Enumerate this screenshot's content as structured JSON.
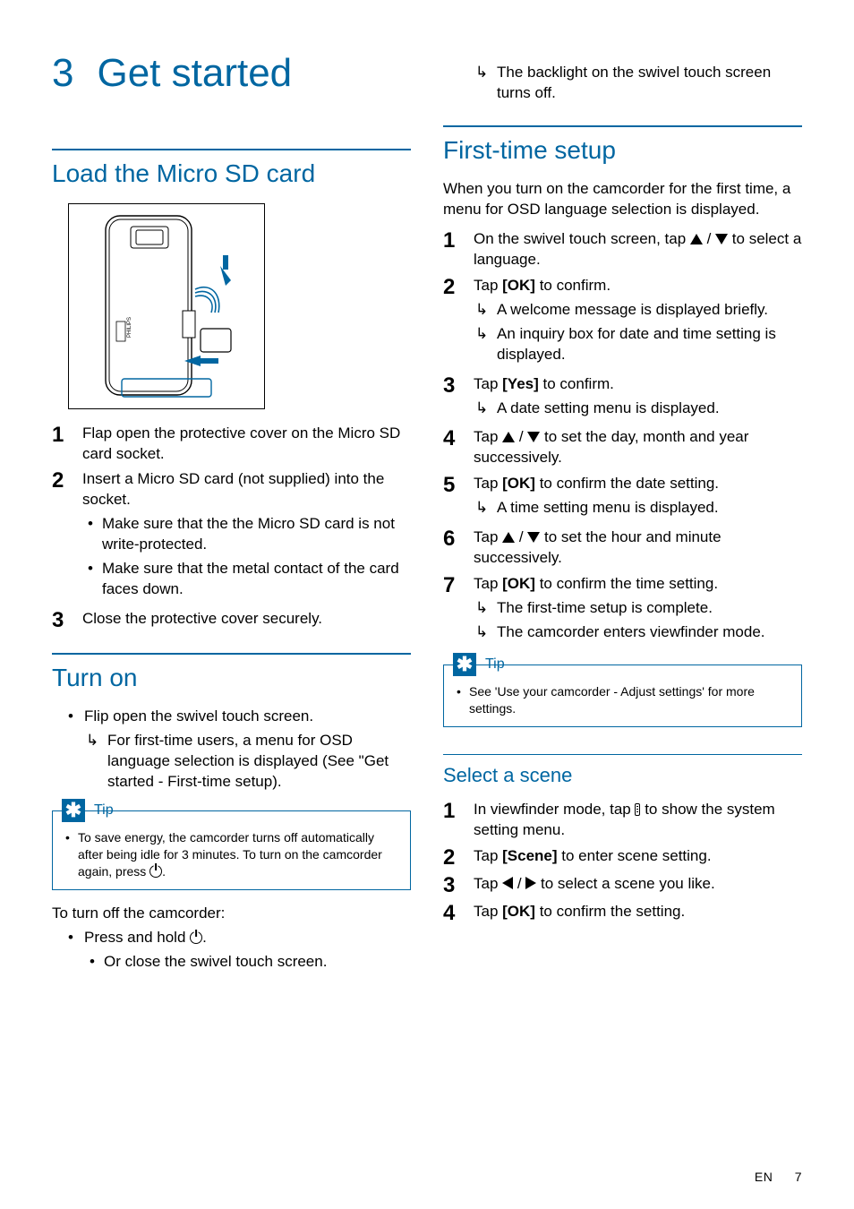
{
  "chapter": {
    "number": "3",
    "title": "Get started"
  },
  "sections": {
    "load_sd": {
      "heading": "Load the Micro SD card",
      "steps": [
        {
          "text": "Flap open the protective cover on the Micro SD card socket."
        },
        {
          "text": "Insert a Micro SD card (not supplied) into the socket.",
          "bullets": [
            "Make sure that the the Micro SD card is not write-protected.",
            "Make sure that the metal contact of the card faces down."
          ]
        },
        {
          "text": "Close the protective cover securely."
        }
      ]
    },
    "turn_on": {
      "heading": "Turn on",
      "bullets": [
        {
          "text": "Flip open the swivel touch screen.",
          "results": [
            "For first-time users, a menu for OSD language selection is displayed (See \"Get started - First-time setup)."
          ]
        }
      ],
      "tip_label": "Tip",
      "tip_text_a": "To save energy, the camcorder turns off automatically after being idle for 3 minutes. To turn on the camcorder again, press ",
      "tip_text_b": ".",
      "turn_off_heading": "To turn off the camcorder:",
      "turn_off_main_a": "Press and hold ",
      "turn_off_main_b": ".",
      "turn_off_sub": "Or close the swivel touch screen.",
      "turn_off_result": "The backlight on the swivel touch screen turns off."
    },
    "first_time": {
      "heading": "First-time setup",
      "intro": "When you turn on the camcorder for the first time, a menu for OSD language selection is displayed.",
      "steps": [
        {
          "pre": "On the swivel touch screen, tap ",
          "post": " to select a language.",
          "icons": "updown"
        },
        {
          "pre": "Tap ",
          "bold": "[OK]",
          "post": " to confirm.",
          "results": [
            "A welcome message is displayed briefly.",
            "An inquiry box for date and time setting is displayed."
          ]
        },
        {
          "pre": "Tap ",
          "bold": "[Yes]",
          "post": " to confirm.",
          "results": [
            "A date setting menu is displayed."
          ]
        },
        {
          "pre": "Tap ",
          "post": " to set the day, month and year successively.",
          "icons": "updown"
        },
        {
          "pre": "Tap ",
          "bold": "[OK]",
          "post": " to confirm the date setting.",
          "results": [
            "A time setting menu is displayed."
          ]
        },
        {
          "pre": "Tap ",
          "post": " to set the hour and minute successively.",
          "icons": "updown"
        },
        {
          "pre": "Tap ",
          "bold": "[OK]",
          "post": " to confirm the time setting.",
          "results": [
            "The first-time setup is complete.",
            "The camcorder enters viewfinder mode."
          ]
        }
      ],
      "tip_label": "Tip",
      "tip_text": "See 'Use your camcorder - Adjust settings' for more settings."
    },
    "select_scene": {
      "heading": "Select a scene",
      "steps": [
        {
          "pre": "In viewfinder mode, tap ",
          "post": " to show the system setting menu.",
          "icons": "menu"
        },
        {
          "pre": "Tap ",
          "bold": "[Scene]",
          "post": " to enter scene setting."
        },
        {
          "pre": "Tap ",
          "post": " to select a scene you like.",
          "icons": "leftright"
        },
        {
          "pre": "Tap ",
          "bold": "[OK]",
          "post": " to confirm the setting."
        }
      ]
    }
  },
  "footer": {
    "lang": "EN",
    "page": "7"
  }
}
